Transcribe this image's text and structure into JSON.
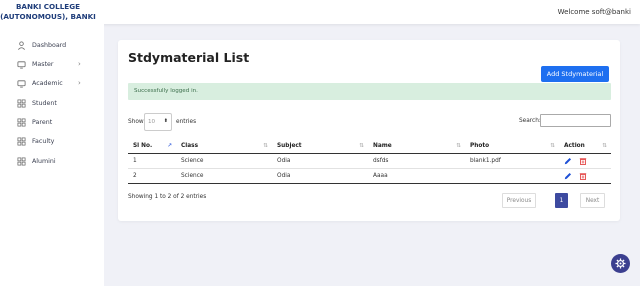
{
  "header": {
    "brand_line1": "BANKI COLLEGE",
    "brand_line2": "(AUTONOMOUS), BANKI",
    "welcome": "Welcome soft@banki"
  },
  "sidebar": {
    "items": [
      {
        "label": "Dashboard",
        "icon": "person-icon"
      },
      {
        "label": "Master",
        "icon": "monitor-icon",
        "expandable": true
      },
      {
        "label": "Academic",
        "icon": "monitor-icon",
        "expandable": true
      },
      {
        "label": "Student",
        "icon": "grid-icon"
      },
      {
        "label": "Parent",
        "icon": "grid-icon"
      },
      {
        "label": "Faculty",
        "icon": "grid-icon"
      },
      {
        "label": "Alumini",
        "icon": "grid-icon"
      }
    ]
  },
  "main": {
    "title": "Stdymaterial List",
    "add_button": "Add Stdymaterial",
    "alert": "Successfully logged in.",
    "show_label": "Show",
    "length_value": "10",
    "entries_label": "entries",
    "search_label": "Search:",
    "columns": [
      "Sl No.",
      "Class",
      "Subject",
      "Name",
      "Photo",
      "Action"
    ],
    "rows": [
      [
        "1",
        "Science",
        "Odia",
        "dsfds",
        "blank1.pdf"
      ],
      [
        "2",
        "Science",
        "Odia",
        "Aaaa",
        ""
      ]
    ],
    "info": "Showing 1 to 2 of 2 entries",
    "pagination": {
      "previous": "Previous",
      "current": "1",
      "next": "Next"
    }
  },
  "colors": {
    "primary_button": "#1e6ff0",
    "alert_bg": "#d8eedf",
    "active_page": "#3d4aa0",
    "brand_text": "#1f3d7a",
    "edit_icon": "#1e50d6",
    "delete_icon": "#e03131"
  }
}
